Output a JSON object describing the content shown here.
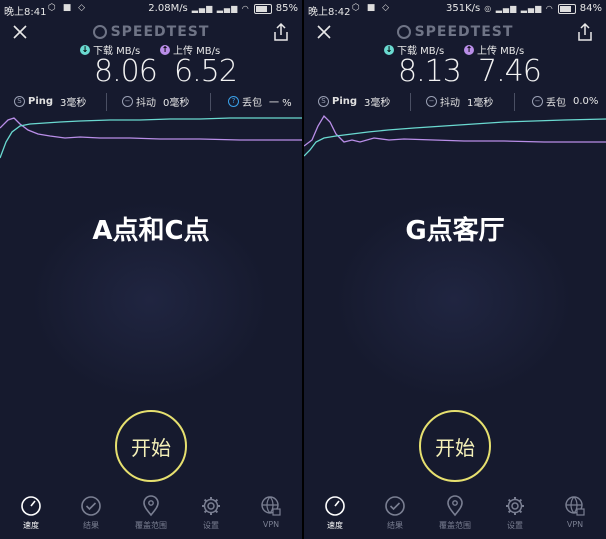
{
  "panels": [
    {
      "status": {
        "time": "晚上8:41",
        "net_speed": "2.08M/s",
        "battery": "85%"
      },
      "logo": "SPEEDTEST",
      "download": {
        "label": "下载 MB/s",
        "value": "8.06"
      },
      "upload": {
        "label": "上传 MB/s",
        "value": "6.52"
      },
      "ping": {
        "label": "Ping",
        "value": "3毫秒"
      },
      "jitter": {
        "label": "抖动",
        "value": "0毫秒"
      },
      "loss": {
        "label": "丢包",
        "value": "一 %"
      },
      "location_label": "A点和C点",
      "start_label": "开始"
    },
    {
      "status": {
        "time": "晚上8:42",
        "net_speed": "351K/s",
        "battery": "84%"
      },
      "logo": "SPEEDTEST",
      "download": {
        "label": "下载 MB/s",
        "value": "8.13"
      },
      "upload": {
        "label": "上传 MB/s",
        "value": "7.46"
      },
      "ping": {
        "label": "Ping",
        "value": "3毫秒"
      },
      "jitter": {
        "label": "抖动",
        "value": "1毫秒"
      },
      "loss": {
        "label": "丢包",
        "value": "0.0%"
      },
      "location_label": "G点客厅",
      "start_label": "开始"
    }
  ],
  "tabs": [
    "速度",
    "结果",
    "覆盖范围",
    "设置",
    "VPN"
  ],
  "colors": {
    "download": "#6ad9d0",
    "upload": "#b98ee8",
    "start_ring": "#e6e06f",
    "background": "#161a2e"
  },
  "icons": {
    "close": "close-icon",
    "share": "share-icon",
    "speed": "speedometer-icon",
    "results": "check-circle-icon",
    "coverage": "map-pin-icon",
    "settings": "gear-icon",
    "vpn": "globe-lock-icon"
  }
}
